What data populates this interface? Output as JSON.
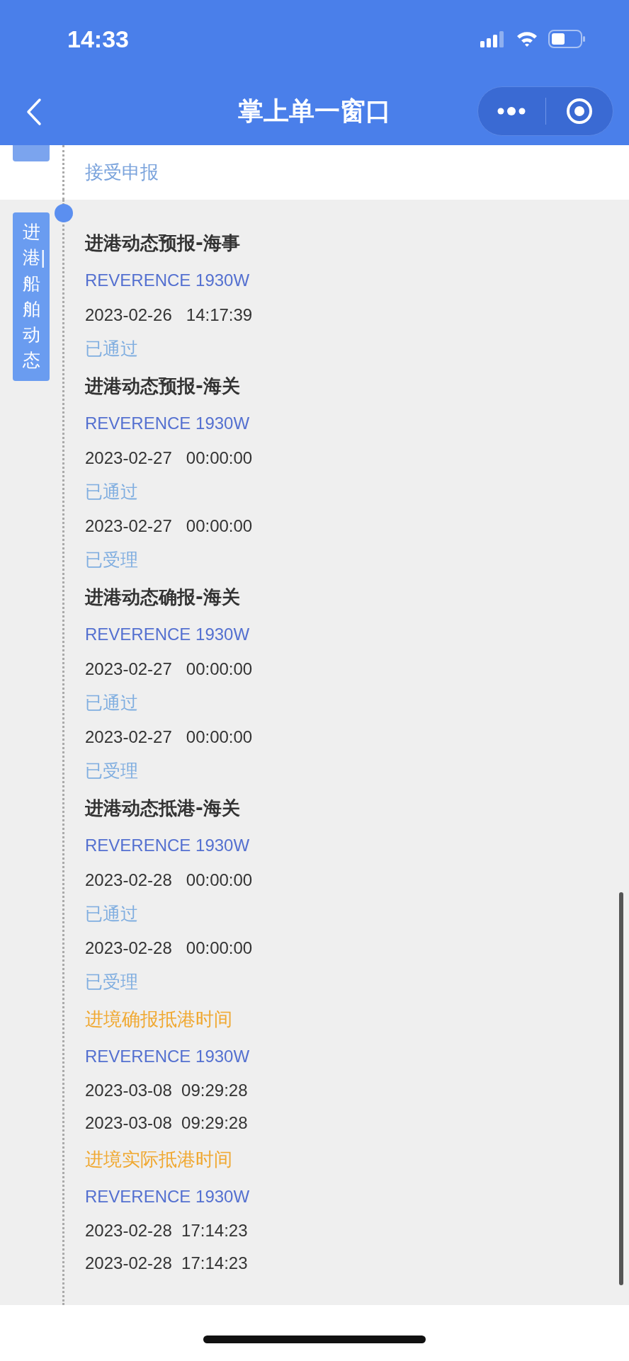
{
  "status_bar": {
    "time": "14:33"
  },
  "nav": {
    "title": "掌上单一窗口"
  },
  "prev_section": {
    "label": "接受申报"
  },
  "section": {
    "tag": "进港|船舶动态",
    "items": [
      {
        "kind": "declaration",
        "title": "进港动态预报-海事",
        "ship": "REVERENCE 1930W",
        "records": [
          {
            "date": "2023-02-26",
            "time": "14:17:39",
            "status": "已通过"
          }
        ]
      },
      {
        "kind": "declaration",
        "title": "进港动态预报-海关",
        "ship": "REVERENCE 1930W",
        "records": [
          {
            "date": "2023-02-27",
            "time": "00:00:00",
            "status": "已通过"
          },
          {
            "date": "2023-02-27",
            "time": "00:00:00",
            "status": "已受理"
          }
        ]
      },
      {
        "kind": "declaration",
        "title": "进港动态确报-海关",
        "ship": "REVERENCE 1930W",
        "records": [
          {
            "date": "2023-02-27",
            "time": "00:00:00",
            "status": "已通过"
          },
          {
            "date": "2023-02-27",
            "time": "00:00:00",
            "status": "已受理"
          }
        ]
      },
      {
        "kind": "declaration",
        "title": "进港动态抵港-海关",
        "ship": "REVERENCE 1930W",
        "records": [
          {
            "date": "2023-02-28",
            "time": "00:00:00",
            "status": "已通过"
          },
          {
            "date": "2023-02-28",
            "time": "00:00:00",
            "status": "已受理"
          }
        ]
      },
      {
        "kind": "arrival_time",
        "title": "进境确报抵港时间",
        "ship": "REVERENCE 1930W",
        "records": [
          {
            "date": "2023-03-08",
            "time": "09:29:28"
          },
          {
            "date": "2023-03-08",
            "time": "09:29:28"
          }
        ]
      },
      {
        "kind": "arrival_time",
        "title": "进境实际抵港时间",
        "ship": "REVERENCE 1930W",
        "records": [
          {
            "date": "2023-02-28",
            "time": "17:14:23"
          },
          {
            "date": "2023-02-28",
            "time": "17:14:23"
          }
        ]
      }
    ]
  }
}
